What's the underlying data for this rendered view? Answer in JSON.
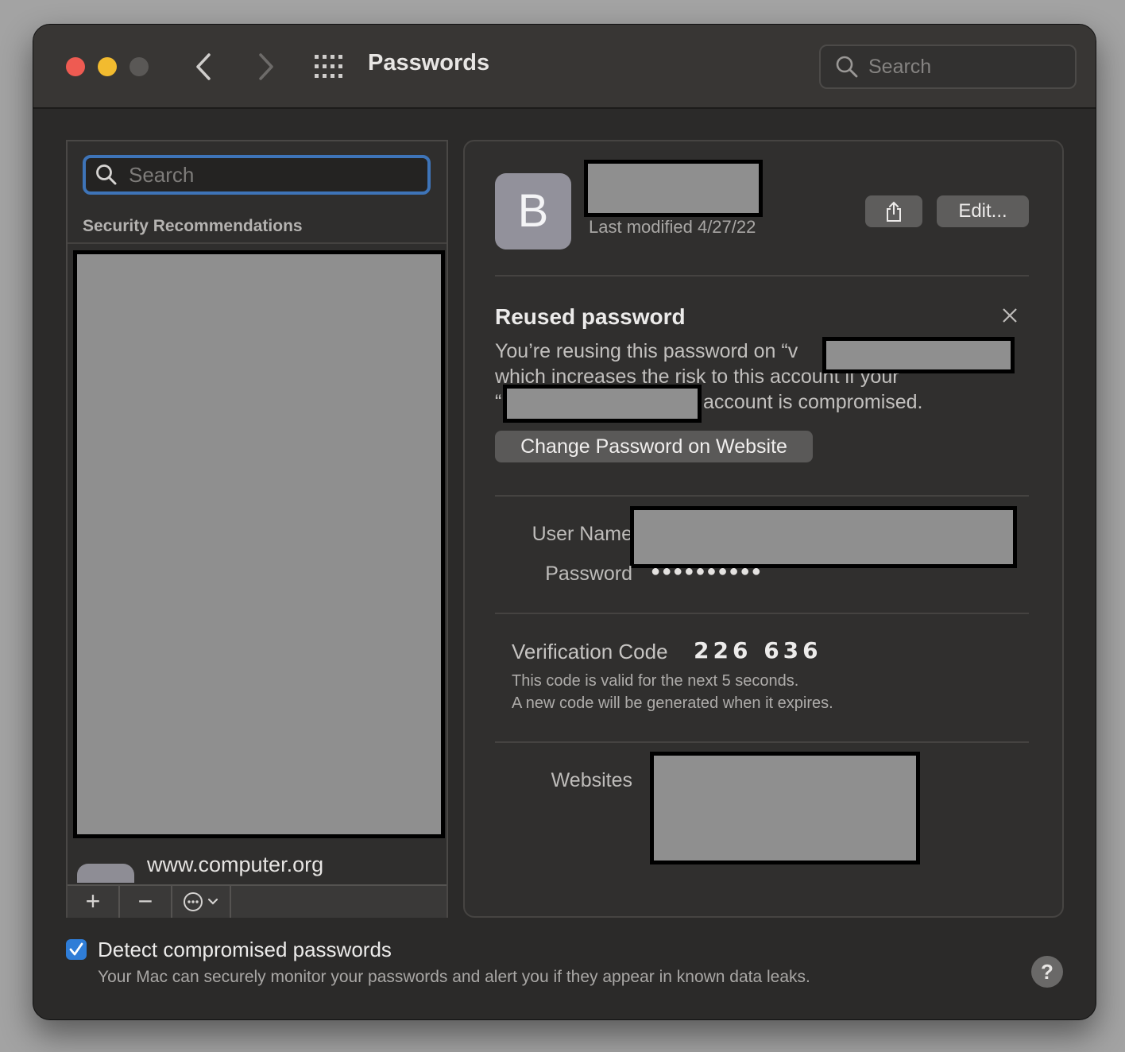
{
  "window": {
    "title": "Passwords",
    "search_placeholder": "Search"
  },
  "sidebar": {
    "search_placeholder": "Search",
    "section_header": "Security Recommendations",
    "peek_item_title": "www.computer.org",
    "toolbar": {
      "add_label": "+",
      "remove_label": "−",
      "more_icon": "ellipsis-circle-icon"
    }
  },
  "detail": {
    "avatar_letter": "B",
    "last_modified": "Last modified 4/27/22",
    "edit_label": "Edit...",
    "share_icon": "share-icon",
    "alert": {
      "title": "Reused password",
      "line1": "You’re reusing this password on “v",
      "line2": "which increases the risk to this account if your",
      "line3_prefix": "“",
      "line3_suffix": "account is compromised.",
      "change_button": "Change Password on Website"
    },
    "fields": {
      "username_label": "User Name",
      "password_label": "Password",
      "password_value": "●●●●●●●●●●"
    },
    "verification": {
      "label": "Verification Code",
      "code": "226 636",
      "note1": "This code is valid for the next 5 seconds.",
      "note2": "A new code will be generated when it expires."
    },
    "websites_label": "Websites"
  },
  "footer": {
    "detect_label": "Detect compromised passwords",
    "detect_checked": true,
    "detect_description": "Your Mac can securely monitor your passwords and alert you if they appear in known data leaks.",
    "help_label": "?"
  },
  "colors": {
    "accent": "#2f7dd7",
    "focus_ring": "#3e74b8",
    "redaction": "#8f8f8f",
    "close": "#ee5b52",
    "minimize": "#f2bb2f"
  }
}
